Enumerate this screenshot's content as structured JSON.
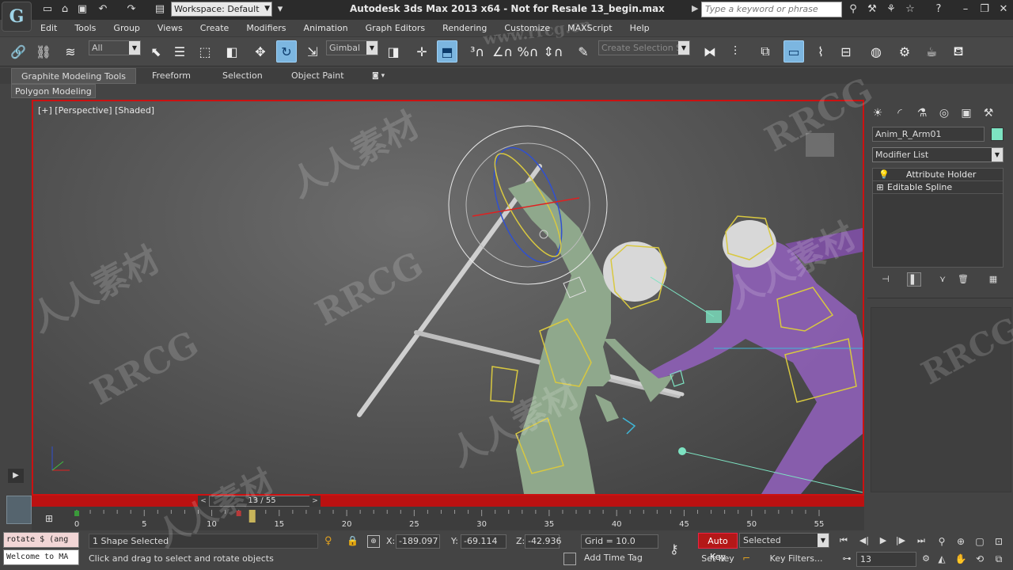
{
  "titlebar": {
    "workspace": "Workspace: Default",
    "title": "Autodesk 3ds Max  2013 x64    - Not for Resale    13_begin.max",
    "search_placeholder": "Type a keyword or phrase"
  },
  "menu": [
    "Edit",
    "Tools",
    "Group",
    "Views",
    "Create",
    "Modifiers",
    "Animation",
    "Graph Editors",
    "Rendering",
    "Customize",
    "MAXScript",
    "Help"
  ],
  "toolbar": {
    "filter_value": "All",
    "ref_coord_value": "Gimbal",
    "named_selection_placeholder": "Create Selection Se"
  },
  "ribbon": {
    "tabs": [
      "Graphite Modeling Tools",
      "Freeform",
      "Selection",
      "Object Paint"
    ],
    "panel_label": "Polygon Modeling"
  },
  "viewport": {
    "label": "[+] [Perspective] [Shaded]"
  },
  "command_panel": {
    "object_name": "Anim_R_Arm01",
    "object_color": "#7de3c2",
    "modifier_list": "Modifier List",
    "stack": [
      "Attribute Holder",
      "Editable Spline"
    ]
  },
  "timeline": {
    "current_frame": 13,
    "total_frames": 55,
    "frame_readout": "13 / 55",
    "ticks": [
      0,
      5,
      10,
      15,
      20,
      25,
      30,
      35,
      40,
      45,
      50,
      55
    ],
    "keys": [
      0,
      12,
      13
    ]
  },
  "status": {
    "maxscript_line1": "rotate $ (ang",
    "maxscript_line2": "Welcome to MA",
    "selection_count": "1 Shape Selected",
    "prompt": "Click and drag to select and rotate objects",
    "x_label": "X:",
    "x_value": "-189.097",
    "y_label": "Y:",
    "y_value": "-69.114",
    "z_label": "Z:",
    "z_value": "-42.936",
    "grid": "Grid = 10.0",
    "add_time_tag": "Add Time Tag",
    "auto_key": "Auto Key",
    "set_key": "Set Key",
    "key_mode": "Selected",
    "key_filters": "Key Filters...",
    "frame_field": "13"
  },
  "watermark": {
    "latin": "RRCG",
    "cjk": "人人素材",
    "url": "www.rrcg.cn"
  },
  "colors": {
    "active_viewport_border": "#cc1111",
    "auto_key": "#b41818",
    "gizmo_red": "#e02020",
    "gizmo_blue": "#3050d0",
    "gizmo_yellow": "#d8c840",
    "character_green": "#8fa88c",
    "character_purple": "#9060b0"
  }
}
